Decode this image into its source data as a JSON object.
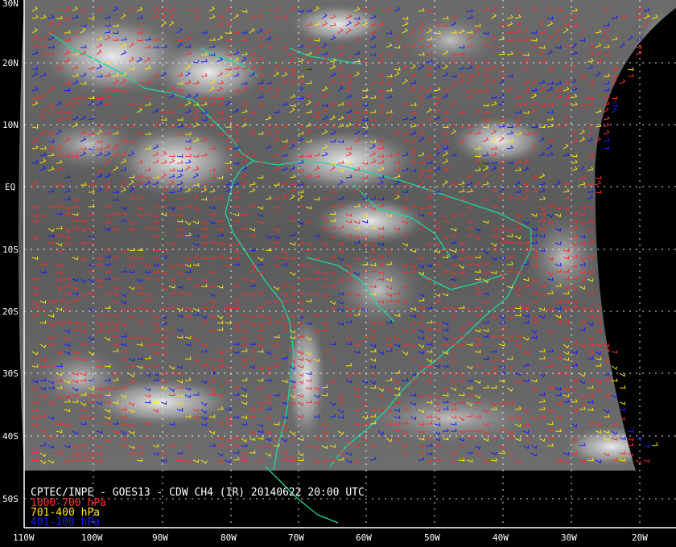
{
  "map": {
    "lat_labels": [
      "30N",
      "20N",
      "10N",
      "EQ",
      "10S",
      "20S",
      "30S",
      "40S",
      "50S"
    ],
    "lon_labels": [
      "110W",
      "100W",
      "90W",
      "80W",
      "70W",
      "60W",
      "50W",
      "40W",
      "30W",
      "20W"
    ],
    "colors": {
      "background": "#000000",
      "grid": "#ffffff",
      "coastline": "#22d3a0",
      "low_level": "#ff2a2a",
      "mid_level": "#ffe600",
      "high_level": "#1a1aff"
    }
  },
  "caption": {
    "title": "CPTEC/INPE - GOES13 - CDW CH4 (IR) 20140622 20:00 UTC",
    "legend": [
      {
        "label": "1000-700 hPa",
        "color": "#ff2a2a"
      },
      {
        "label": "701-400 hPa",
        "color": "#ffe600"
      },
      {
        "label": "401-100 hPa",
        "color": "#1a1aff"
      }
    ]
  }
}
